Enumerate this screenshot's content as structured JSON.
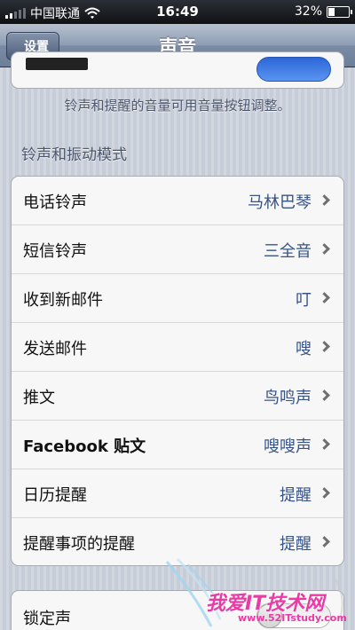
{
  "status_bar": {
    "carrier": "中国联通",
    "time": "16:49",
    "battery": "32%",
    "battery_level": 0.32
  },
  "nav": {
    "back_label": "设置",
    "title": "声音"
  },
  "volume_note": "铃声和提醒的音量可用音量按钮调整。",
  "section_header": "铃声和振动模式",
  "rows": [
    {
      "label": "电话铃声",
      "value": "马林巴琴"
    },
    {
      "label": "短信铃声",
      "value": "三全音"
    },
    {
      "label": "收到新邮件",
      "value": "叮"
    },
    {
      "label": "发送邮件",
      "value": "嗖"
    },
    {
      "label": "推文",
      "value": "鸟鸣声"
    },
    {
      "label": "Facebook 贴文",
      "value": "嗖嗖声"
    },
    {
      "label": "日历提醒",
      "value": "提醒"
    },
    {
      "label": "提醒事项的提醒",
      "value": "提醒"
    }
  ],
  "lock_sound": {
    "label": "锁定声"
  },
  "watermark": {
    "text": "我爱IT技术网",
    "url": "www.52ITstudy.com"
  },
  "colors": {
    "value_text": "#385487",
    "nav_bar": "#7a8ba5",
    "watermark": "#e93aa5"
  }
}
